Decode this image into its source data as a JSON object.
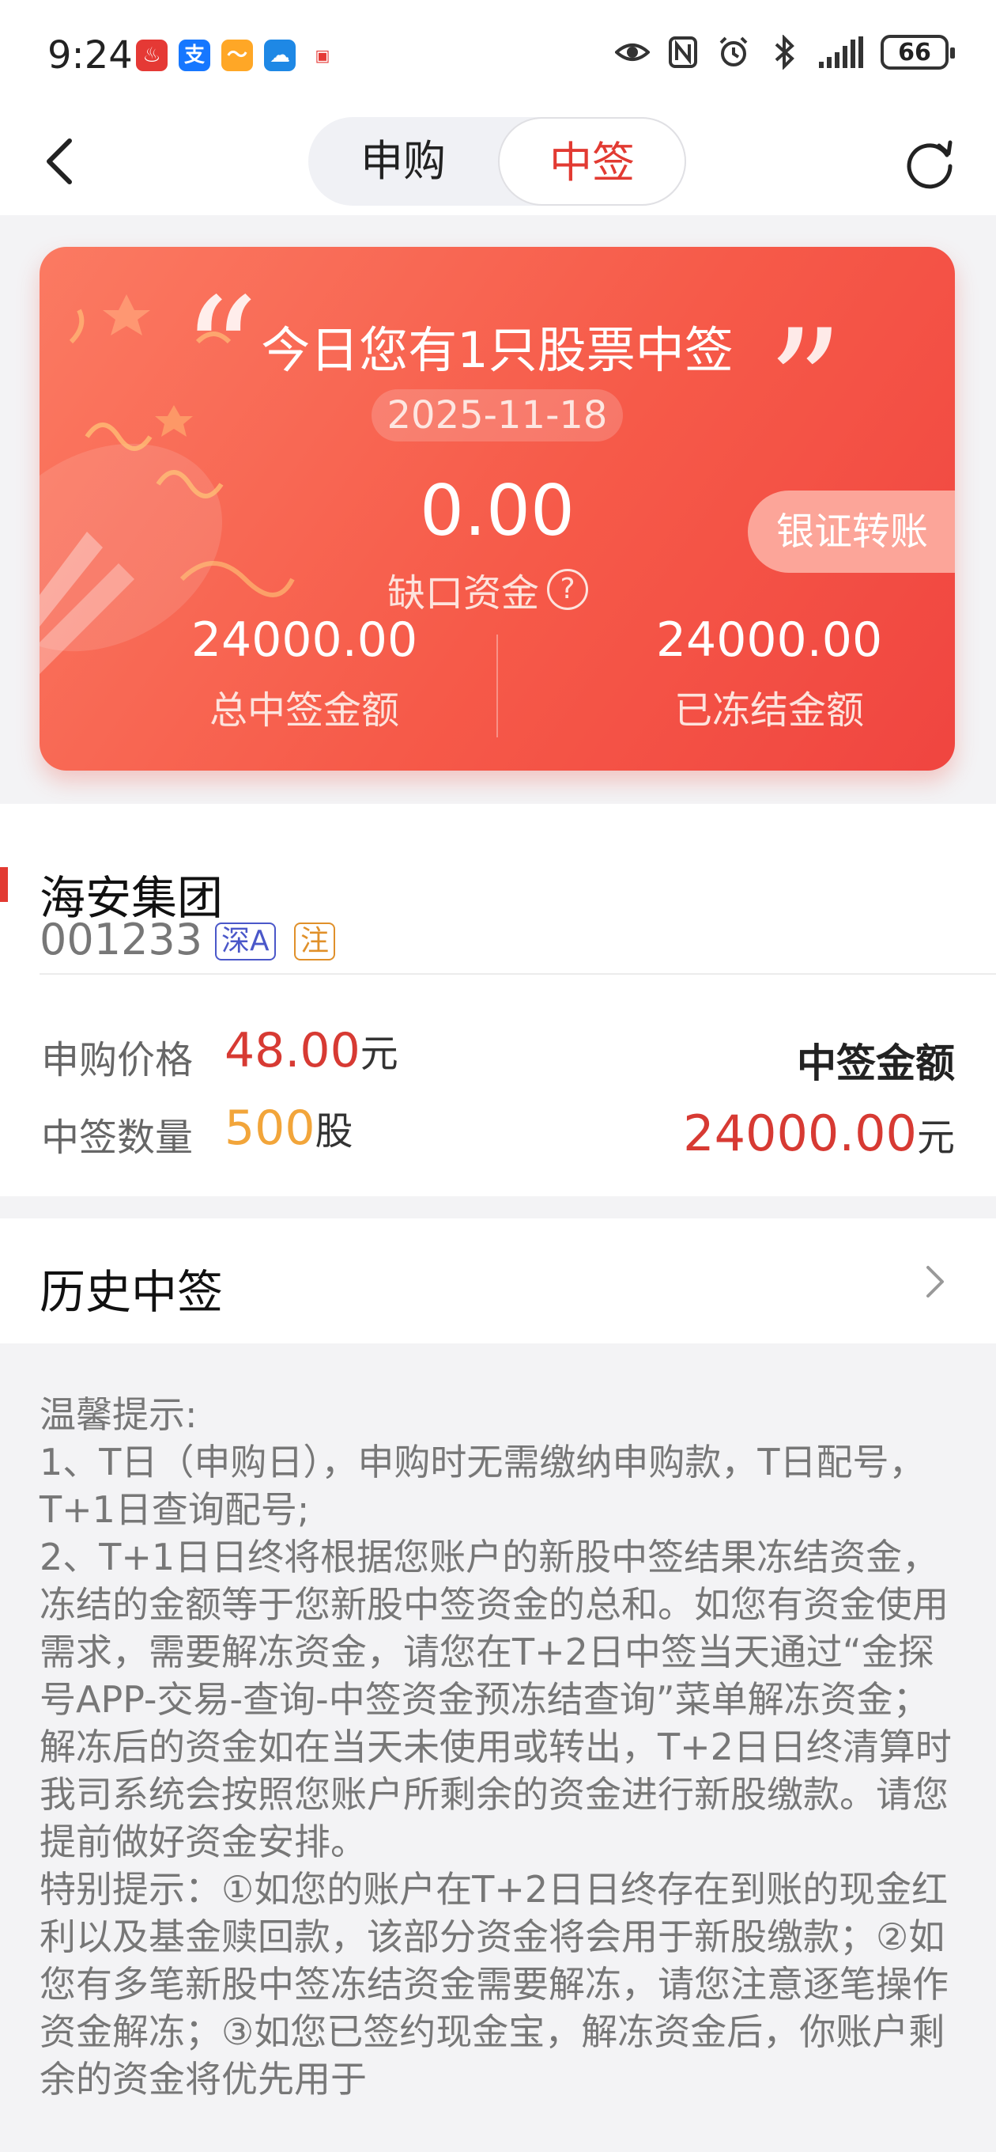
{
  "status_bar": {
    "time": "9:24",
    "apps": [
      {
        "icon": "security-app-icon",
        "glyph": "♨",
        "color": "#e53935"
      },
      {
        "icon": "alipay-icon",
        "glyph": "支",
        "color": "#1677ff"
      },
      {
        "icon": "wallet-app-icon",
        "glyph": "〜",
        "color": "#ffa726"
      },
      {
        "icon": "weather-icon",
        "glyph": "☁",
        "color": "#1e88e5"
      }
    ],
    "battery": "66"
  },
  "header": {
    "tabs": [
      {
        "label": "申购",
        "active": false
      },
      {
        "label": "中签",
        "active": true
      }
    ]
  },
  "card": {
    "headline": "今日您有1只股票中签",
    "date": "2025-11-18",
    "gap_value": "0.00",
    "gap_label": "缺口资金",
    "help_icon": "?",
    "transfer_button": "银证转账",
    "total_win_value": "24000.00",
    "total_win_label": "总中签金额",
    "frozen_value": "24000.00",
    "frozen_label": "已冻结金额"
  },
  "stock": {
    "name": "海安集团",
    "code": "001233",
    "market_tag": "深A",
    "note_tag": "注",
    "price_label": "申购价格",
    "price_value": "48.00",
    "price_unit": "元",
    "qty_label": "中签数量",
    "qty_value": "500",
    "qty_unit": "股",
    "win_amount_label": "中签金额",
    "win_amount_value": "24000.00",
    "win_amount_unit": "元"
  },
  "history": {
    "label": "历史中签"
  },
  "tips": {
    "text": "温馨提示:\n1、T日（申购日），申购时无需缴纳申购款，T日配号，T+1日查询配号;\n2、T+1日日终将根据您账户的新股中签结果冻结资金，冻结的金额等于您新股中签资金的总和。如您有资金使用需求，需要解冻资金，请您在T+2日中签当天通过“金探号APP-交易-查询-中签资金预冻结查询”菜单解冻资金；解冻后的资金如在当天未使用或转出，T+2日日终清算时我司系统会按照您账户所剩余的资金进行新股缴款。请您提前做好资金安排。\n特别提示：①如您的账户在T+2日日终存在到账的现金红利以及基金赎回款，该部分资金将会用于新股缴款；②如您有多笔新股中签冻结资金需要解冻，请您注意逐笔操作资金解冻；③如您已签约现金宝，解冻资金后，你账户剩余的资金将优先用于"
  },
  "colors": {
    "accent_red": "#e23a32",
    "card_gradient_start": "#fb7a62",
    "card_gradient_end": "#f04540",
    "qty_orange": "#f2a53a",
    "market_tag_blue": "#4a57c9"
  }
}
